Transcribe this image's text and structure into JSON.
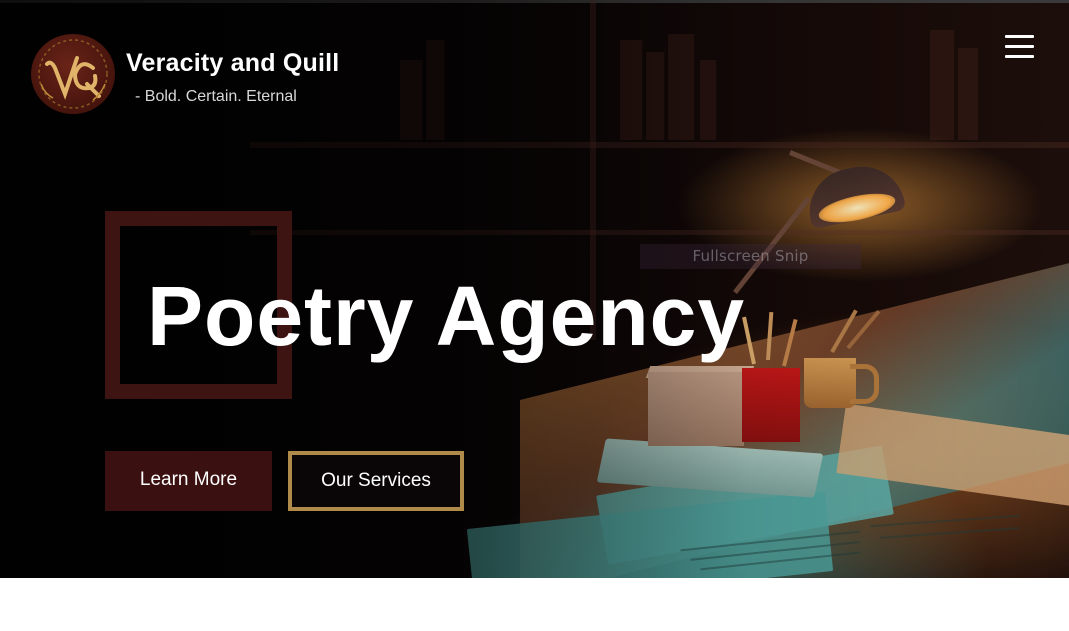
{
  "brand": {
    "name": "Veracity and Quill",
    "tagline": "- Bold. Certain. Eternal"
  },
  "hero": {
    "title": "Poetry Agency",
    "overlay_text": "Fullscreen Snip"
  },
  "buttons": {
    "learn_more": "Learn More",
    "our_services": "Our Services"
  },
  "icons": {
    "logo": "vq-monogram-logo",
    "menu": "hamburger-menu-icon"
  },
  "colors": {
    "accent_maroon": "#3e1412",
    "button_maroon": "#3a1010",
    "gold_border": "#b08a48",
    "text_white": "#ffffff",
    "tagline_gray": "#d8d8d8"
  }
}
